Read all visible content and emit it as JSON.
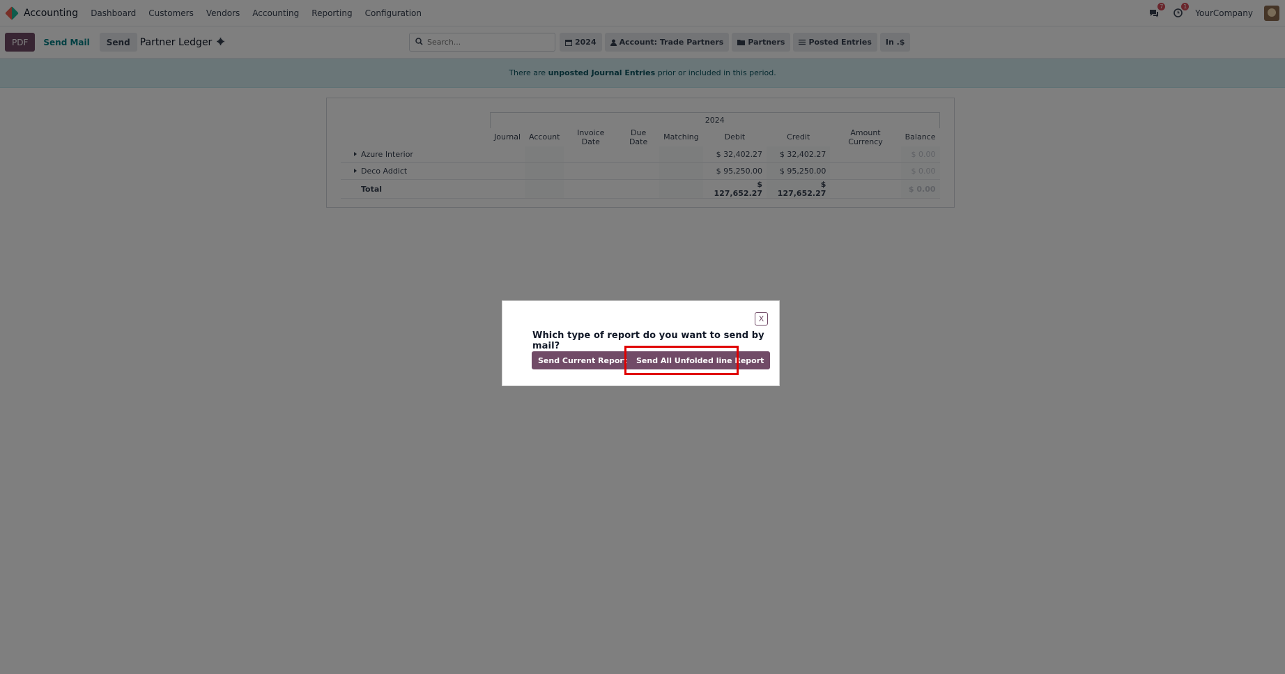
{
  "navbar": {
    "app_name": "Accounting",
    "menu": [
      "Dashboard",
      "Customers",
      "Vendors",
      "Accounting",
      "Reporting",
      "Configuration"
    ],
    "messages_badge": "7",
    "activity_badge": "1",
    "company": "YourCompany"
  },
  "control": {
    "pdf_label": "PDF",
    "send_mail_label": "Send Mail",
    "send_label": "Send",
    "report_title": "Partner Ledger",
    "search_placeholder": "Search...",
    "filters": [
      "2024",
      "Account: Trade Partners",
      "Partners",
      "Posted Entries",
      "In .$"
    ]
  },
  "alert": {
    "prefix": "There are ",
    "bold": "unposted Journal Entries",
    "suffix": " prior or included in this period."
  },
  "report": {
    "year": "2024",
    "columns": [
      "Journal",
      "Account",
      "Invoice Date",
      "Due Date",
      "Matching",
      "Debit",
      "Credit",
      "Amount Currency",
      "Balance"
    ],
    "rows": [
      {
        "name": "Azure Interior",
        "debit": "$ 32,402.27",
        "credit": "$ 32,402.27",
        "balance": "$ 0.00"
      },
      {
        "name": "Deco Addict",
        "debit": "$ 95,250.00",
        "credit": "$ 95,250.00",
        "balance": "$ 0.00"
      }
    ],
    "total": {
      "name": "Total",
      "debit": "$ 127,652.27",
      "credit": "$ 127,652.27",
      "balance": "$ 0.00"
    }
  },
  "modal": {
    "close_label": "X",
    "question": "Which type of report do you want to send by mail?",
    "btn_current": "Send Current Report",
    "btn_unfolded": "Send All Unfolded line Report"
  },
  "colors": {
    "primary": "#714b67",
    "link": "#017e84",
    "highlight": "#e00000"
  }
}
